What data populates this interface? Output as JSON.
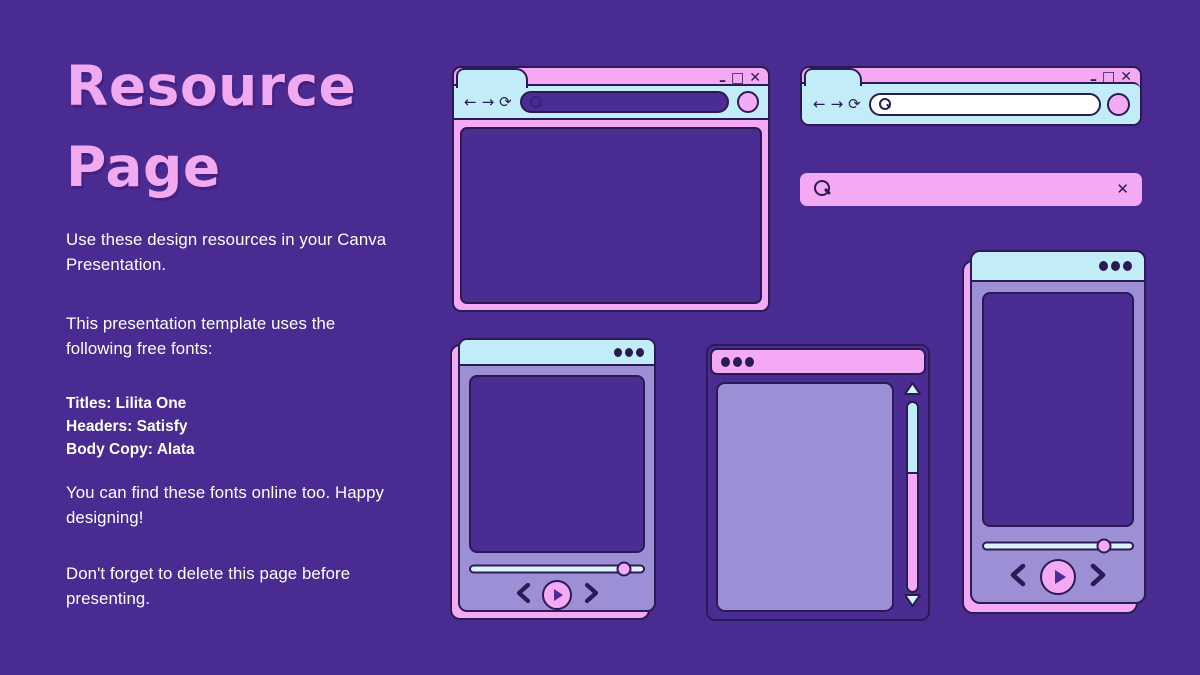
{
  "slide": {
    "background_color": "#4a2b91",
    "accent_pink": "#f4a9f4",
    "accent_blue": "#c2ecf8",
    "ink": "#2b1b54",
    "lavender": "#9d8fd6"
  },
  "title": {
    "line1": "Resource",
    "line2": "Page"
  },
  "body": {
    "intro": "Use these design resources in your Canva Presentation.",
    "fonts_intro": "This presentation template uses the following free fonts:",
    "fonts": {
      "titles": "Titles: Lilita One",
      "headers": "Headers: Satisfy",
      "body_copy": "Body Copy: Alata"
    },
    "find_online": "You can find these fonts online too. Happy designing!",
    "delete_note": "Don't forget to delete this page before presenting."
  },
  "mockups": {
    "browser_large": {
      "name": "Large browser window",
      "window_controls": {
        "minimize": "–",
        "maximize": "□",
        "close": "✕"
      },
      "nav": {
        "back": "←",
        "forward": "→",
        "reload": "⟳"
      },
      "url_value": "",
      "url_placeholder": "",
      "search_icon": "search-icon",
      "avatar": "profile-avatar"
    },
    "browser_small": {
      "name": "Compact browser window",
      "window_controls": {
        "minimize": "–",
        "maximize": "□",
        "close": "✕"
      },
      "nav": {
        "back": "←",
        "forward": "→",
        "reload": "⟳"
      },
      "url_value": "",
      "url_placeholder": "",
      "search_icon": "search-icon",
      "avatar": "profile-avatar"
    },
    "search_pill": {
      "name": "Search field",
      "value": "",
      "placeholder": "",
      "search_icon": "search-icon",
      "clear_icon": "✕"
    },
    "phone_left": {
      "name": "Media player phone mockup",
      "dots": 3,
      "progress_percent": 88,
      "controls": {
        "previous": "previous-track",
        "play": "play",
        "next": "next-track"
      }
    },
    "window_scroll": {
      "name": "Scrollable window mockup",
      "dots": 3,
      "scroll_position_percent": 38,
      "scroll_up": "▲",
      "scroll_down": "▼"
    },
    "phone_right": {
      "name": "Tall media player phone mockup",
      "dots": 3,
      "progress_percent": 80,
      "controls": {
        "previous": "previous-track",
        "play": "play",
        "next": "next-track"
      }
    }
  }
}
